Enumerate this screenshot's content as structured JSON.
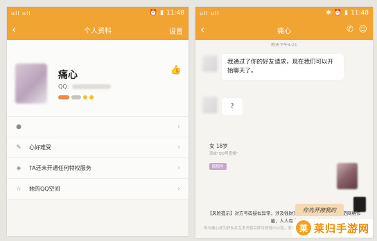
{
  "left": {
    "status": {
      "signal": "ull ull",
      "time": "11:48"
    },
    "titlebar": {
      "title": "个人资料",
      "right_btn": "设置"
    },
    "profile": {
      "name": "痛心",
      "qq_label": "QQ:"
    },
    "rows": [
      {
        "icon": "person-icon",
        "label": ""
      },
      {
        "icon": "pen-icon",
        "label": "心好难受"
      },
      {
        "icon": "shield-icon",
        "label": "TA还未开通任何特权服务"
      },
      {
        "icon": "star-icon",
        "label": "她的QQ空间"
      }
    ]
  },
  "right": {
    "status": {
      "signal": "ull ull",
      "time": "11:48"
    },
    "titlebar": {
      "title": "痛心"
    },
    "chat": {
      "time": "昨天下午4:21",
      "msg1": "我通过了你的好友请求，现在我们可以开始聊天了。",
      "msg2": "?",
      "card": {
        "sex_age": "女    18岁",
        "from": "来自\"QQ号查找\"",
        "tag": "陌陌号"
      },
      "risk": "【风险提示】对方号码疑似异常，涉及钱财交易请务必谨慎操作，防范网络诈骗，人人有责",
      "handwritten": "你先开撩我的",
      "footnote": "你与痛心成为好友并互发消息后即可获得小火花，发送语言片段"
    }
  },
  "watermark": {
    "text": "莱归手游网",
    "logo": "莱"
  },
  "colors": {
    "accent": "#f1a431",
    "bubble": "#ffffff",
    "self_bubble": "#f5d9b3"
  }
}
